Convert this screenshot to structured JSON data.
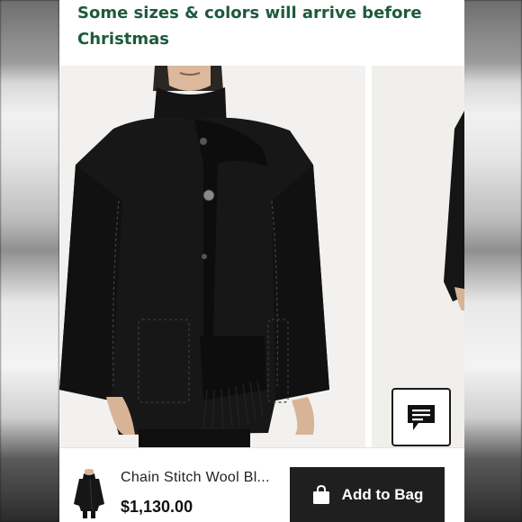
{
  "banner": {
    "notice_text": "Some sizes & colors will arrive before Christmas"
  },
  "product": {
    "name": "Chain Stitch Wool Bl...",
    "price": "$1,130.00"
  },
  "actions": {
    "add_to_bag_label": "Add to Bag"
  },
  "icons": {
    "chat": "chat-icon",
    "bag": "shopping-bag-icon"
  },
  "colors": {
    "notice_green": "#1d5a3d",
    "button_dark": "#1f1f1f"
  }
}
